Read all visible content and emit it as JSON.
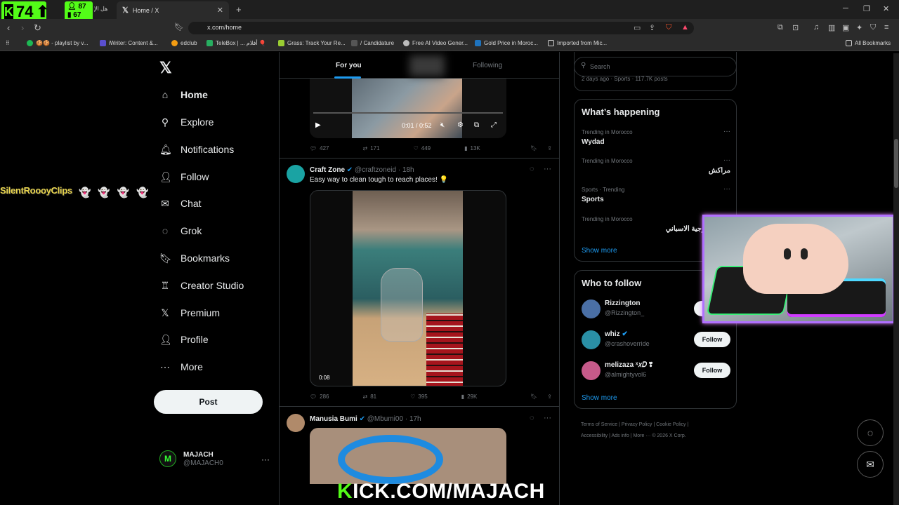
{
  "overlay": {
    "score": "74",
    "stat_a": "87",
    "stat_b": "67",
    "arabic_text": "هل الإ",
    "streamer_name": "SilentRoooyClips",
    "ghosts": "👻👻👻👻",
    "kick_prefix": "K",
    "kick_rest": "ICK.COM/MAJACH"
  },
  "browser": {
    "tab_title": "Home / X",
    "url": "x.com/home",
    "bookmarks": [
      {
        "label": "🍪🍪 - playlist by v...",
        "color": "#1db954"
      },
      {
        "label": "iWriter: Content &...",
        "color": "#5a4fcf"
      },
      {
        "label": "edclub",
        "color": "#f39c12"
      },
      {
        "label": "TeleBox | ... أفلام 🎈",
        "color": "#27ae60"
      },
      {
        "label": "Grass: Track Your Re...",
        "color": "#9acd32"
      },
      {
        "label": "/ Candidature",
        "color": "#555555"
      },
      {
        "label": "Free AI Video Gener...",
        "color": "#bbbbbb"
      },
      {
        "label": "Gold Price in Moroc...",
        "color": "#1e73be"
      },
      {
        "label": "Imported from Mic...",
        "color": "#d6d6d6"
      }
    ],
    "all_bookmarks": "All Bookmarks"
  },
  "sidebar": {
    "items": [
      {
        "label": "Home",
        "icon": "⌂"
      },
      {
        "label": "Explore",
        "icon": "⚲"
      },
      {
        "label": "Notifications",
        "icon": "🔔︎"
      },
      {
        "label": "Follow",
        "icon": "👤︎"
      },
      {
        "label": "Chat",
        "icon": "✉"
      },
      {
        "label": "Grok",
        "icon": "◌"
      },
      {
        "label": "Bookmarks",
        "icon": "🔖︎"
      },
      {
        "label": "Creator Studio",
        "icon": "♖"
      },
      {
        "label": "Premium",
        "icon": "𝕏"
      },
      {
        "label": "Profile",
        "icon": "👤︎"
      },
      {
        "label": "More",
        "icon": "⋯"
      }
    ],
    "post_label": "Post",
    "user": {
      "name": "MAJACH",
      "handle": "@MAJACH0"
    }
  },
  "feed": {
    "tabs": [
      "For you",
      "Following"
    ],
    "post1": {
      "time": "0:01 / 0:52",
      "replies": "427",
      "reposts": "171",
      "likes": "449",
      "views": "13K"
    },
    "post2": {
      "name": "Craft Zone",
      "handle": "@craftzoneid",
      "age": "18h",
      "text": "Easy way to clean tough to reach places! 💡",
      "duration": "0:08",
      "replies": "286",
      "reposts": "81",
      "likes": "395",
      "views": "29K"
    },
    "post3": {
      "name": "Manusia Bumi",
      "handle": "@Mbumi00",
      "age": "17h"
    }
  },
  "right": {
    "search_placeholder": "Search",
    "prev_trend_meta": "2 days ago · Sports · 117.7K posts",
    "happening_title": "What’s happening",
    "trends": [
      {
        "context": "Trending in Morocco",
        "topic": "Wydad",
        "rtl": false
      },
      {
        "context": "Trending in Morocco",
        "topic": "مراكش",
        "rtl": true
      },
      {
        "context": "Sports · Trending",
        "topic": "Sports",
        "rtl": false
      },
      {
        "context": "Trending in Morocco",
        "topic": "وزير الخارجية الاسباني",
        "rtl": true
      }
    ],
    "show_more": "Show more",
    "wtf_title": "Who to follow",
    "who_to_follow": [
      {
        "name": "Rizzington",
        "handle": "@Rizzington_",
        "color": "#4a6fa5"
      },
      {
        "name": "whiz",
        "handle": "@crashoverride",
        "color": "#2a8fa5"
      },
      {
        "name": "melizaza ˣ𝑥𝐷 ❣",
        "handle": "@almightyvol6",
        "color": "#c65a8a"
      }
    ],
    "follow_label": "Follow",
    "footer": [
      "Terms of Service",
      "Privacy Policy",
      "Cookie Policy",
      "Accessibility",
      "Ads info",
      "More ···",
      "© 2026 X Corp."
    ]
  }
}
